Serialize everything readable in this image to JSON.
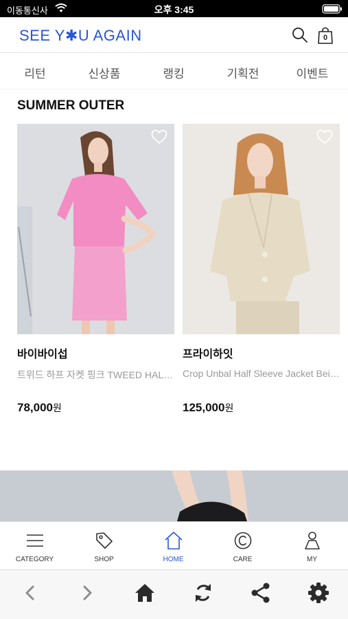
{
  "status_bar": {
    "carrier": "이동통신사",
    "time": "오후 3:45"
  },
  "header": {
    "logo": "SEE Y✱U AGAIN",
    "icons": [
      "search-icon",
      "shopping-bag-icon"
    ],
    "cart_count": "0",
    "brand_color": "#2a55d6"
  },
  "category_nav": {
    "items": [
      {
        "label": "리턴"
      },
      {
        "label": "신상품"
      },
      {
        "label": "랭킹"
      },
      {
        "label": "기획전"
      },
      {
        "label": "이벤트"
      }
    ]
  },
  "section": {
    "title": "SUMMER OUTER"
  },
  "products": [
    {
      "brand": "바이바이섭",
      "name": "트위드 하프 자켓 핑크 TWEED HALF SLEEVE JACKET",
      "price": "78,000",
      "currency": "원",
      "image_tone": "#e9a9c9"
    },
    {
      "brand": "프라이하잇",
      "name": "Crop Unbal Half Sleeve Jacket Beige",
      "price": "125,000",
      "currency": "원",
      "image_tone": "#e7dcc6"
    }
  ],
  "tab_bar": {
    "items": [
      {
        "label": "CATEGORY",
        "icon": "menu-icon"
      },
      {
        "label": "SHOP",
        "icon": "tag-icon"
      },
      {
        "label": "HOME",
        "icon": "home-icon",
        "active": true
      },
      {
        "label": "CARE",
        "icon": "copyright-icon"
      },
      {
        "label": "MY",
        "icon": "user-icon"
      }
    ],
    "active_color": "#2a55d6"
  },
  "browser_toolbar": {
    "icons": [
      "back-arrow-icon",
      "forward-arrow-icon",
      "home-icon",
      "refresh-icon",
      "share-icon",
      "settings-icon"
    ]
  }
}
